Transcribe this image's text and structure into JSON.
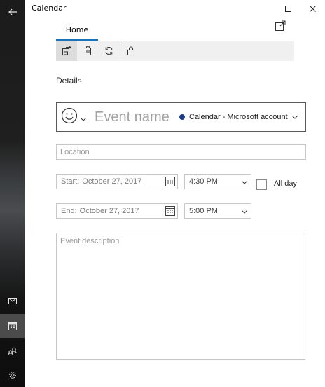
{
  "window": {
    "app_title": "Calendar"
  },
  "sidebar": {
    "items": [
      {
        "icon": "back-arrow-icon"
      },
      {
        "icon": "mail-icon"
      },
      {
        "icon": "calendar-icon",
        "active": true
      },
      {
        "icon": "people-icon"
      },
      {
        "icon": "settings-icon"
      }
    ]
  },
  "tabs": {
    "home_label": "Home"
  },
  "toolbar": {
    "buttons": [
      "save-close-icon",
      "delete-icon",
      "repeat-icon",
      "lock-icon"
    ]
  },
  "details": {
    "section_label": "Details",
    "event_name_placeholder": "Event name",
    "calendar_select": "Calendar - Microsoft account",
    "location_placeholder": "Location",
    "start_label": "Start:",
    "start_date": "October 27, 2017",
    "start_time": "4:30 PM",
    "all_day_label": "All day",
    "end_label": "End:",
    "end_date": "October 27, 2017",
    "end_time": "5:00 PM",
    "description_placeholder": "Event description"
  },
  "colors": {
    "accent": "#0078d7",
    "calendar_dot": "#1e3d8f"
  }
}
